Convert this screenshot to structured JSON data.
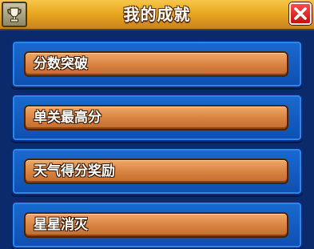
{
  "header": {
    "title": "我的成就",
    "trophy_icon": "trophy-icon",
    "close_icon": "close-icon"
  },
  "achievements": [
    {
      "label": "分数突破"
    },
    {
      "label": "单关最高分"
    },
    {
      "label": "天气得分奖励"
    },
    {
      "label": "星星消灭"
    }
  ],
  "colors": {
    "header": "#e9a820",
    "item": "#d98443",
    "slot": "#1a6ad0",
    "background": "#0b2a6b",
    "close": "#e01b1b"
  }
}
